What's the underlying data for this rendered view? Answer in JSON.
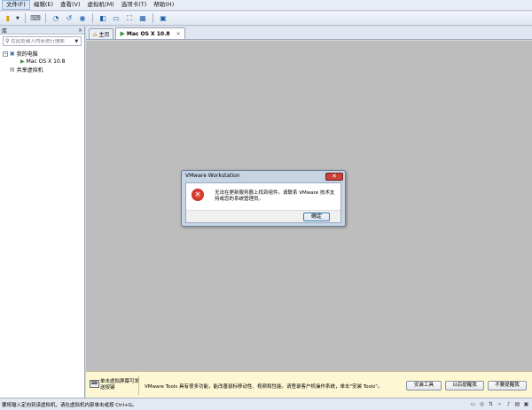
{
  "menubar": {
    "items": [
      "文件(F)",
      "编辑(E)",
      "查看(V)",
      "虚拟机(M)",
      "选项卡(T)",
      "帮助(H)"
    ]
  },
  "toolbar": {
    "icons": [
      "power-icon",
      "play-icon",
      "snapshot-icon",
      "revert-snapshot-icon",
      "manage-snapshots-icon",
      "library-view-icon",
      "thumbnail-view-icon",
      "full-screen-icon",
      "unity-icon",
      "console-view-icon"
    ]
  },
  "library": {
    "title": "库",
    "close": "×",
    "search_placeholder": "在此处键入内容进行搜索",
    "tree": {
      "my_computer": "我的电脑",
      "vm": "Mac OS X 10.8",
      "shared": "共享虚拟机"
    }
  },
  "tabs": [
    {
      "label": "主页",
      "icon": "home-icon"
    },
    {
      "label": "Mac OS X 10.8",
      "icon": "vm-icon",
      "close": "×"
    }
  ],
  "dialog": {
    "title": "VMware Workstation",
    "close": "✕",
    "message": "无法在更新服务器上找到组件。请联系 VMware 技术支持或您的系统管理员。",
    "ok_label": "确定"
  },
  "notification": {
    "hint": "单击虚拟屏幕可发送按键",
    "message": "VMware Tools 具有很多功能，能改善鼠标移动性、视频和性能。请登录客户机操作系统，单击\"安装 Tools\"。",
    "install_label": "安装工具",
    "remind_later_label": "以后提醒我",
    "never_remind_label": "不要提醒我"
  },
  "statusbar": {
    "text": "要将输入定向到该虚拟机，请在虚拟机内部单击或按 Ctrl+G。",
    "icons": [
      "hard-disk-icon",
      "cd-drive-icon",
      "network-icon",
      "usb-icon",
      "sound-icon",
      "printer-icon",
      "display-icon"
    ]
  }
}
